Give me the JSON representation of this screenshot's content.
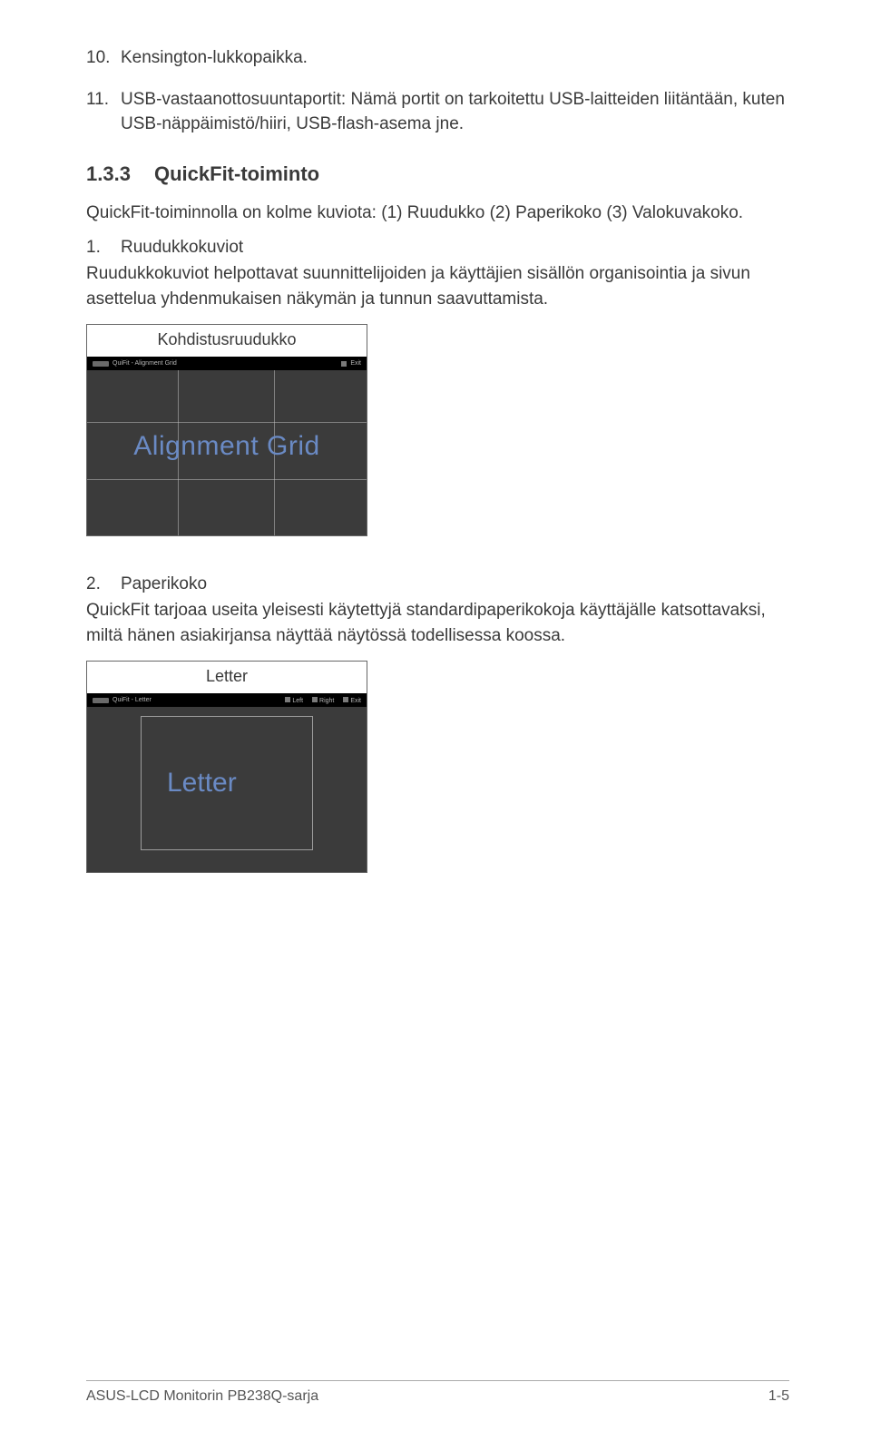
{
  "items": {
    "n10_num": "10.",
    "n10_text": "Kensington-lukkopaikka.",
    "n11_num": "11.",
    "n11_text": "USB-vastaanottosuuntaportit: Nämä portit on tarkoitettu USB-laitteiden liitäntään, kuten USB-näppäimistö/hiiri, USB-flash-asema jne."
  },
  "section": {
    "num": "1.3.3",
    "title": "QuickFit-toiminto",
    "intro": "QuickFit-toiminnolla on kolme kuviota: (1) Ruudukko (2) Paperikoko (3) Valokuvakoko."
  },
  "sub1": {
    "num": "1.",
    "title": "Ruudukkokuviot",
    "body": "Ruudukkokuviot helpottavat suunnittelijoiden ja käyttäjien sisällön organisointia ja sivun asettelua yhdenmukaisen näkymän ja tunnun saavuttamista.",
    "caption": "Kohdistusruudukko",
    "topbar_label": "QuiFit - Alignment Grid",
    "topbar_exit": "Exit",
    "figure_text": "Alignment Grid"
  },
  "sub2": {
    "num": "2.",
    "title": "Paperikoko",
    "body": "QuickFit tarjoaa useita yleisesti käytettyjä standardipaperikokoja käyttäjälle katsottavaksi, miltä hänen asiakirjansa näyttää näytössä todellisessa koossa.",
    "caption": "Letter",
    "topbar_label": "QuiFit - Letter",
    "topbar_left": "Left",
    "topbar_right": "Right",
    "topbar_exit": "Exit",
    "figure_text": "Letter"
  },
  "footer": {
    "left": "ASUS-LCD Monitorin PB238Q-sarja",
    "right": "1-5"
  }
}
